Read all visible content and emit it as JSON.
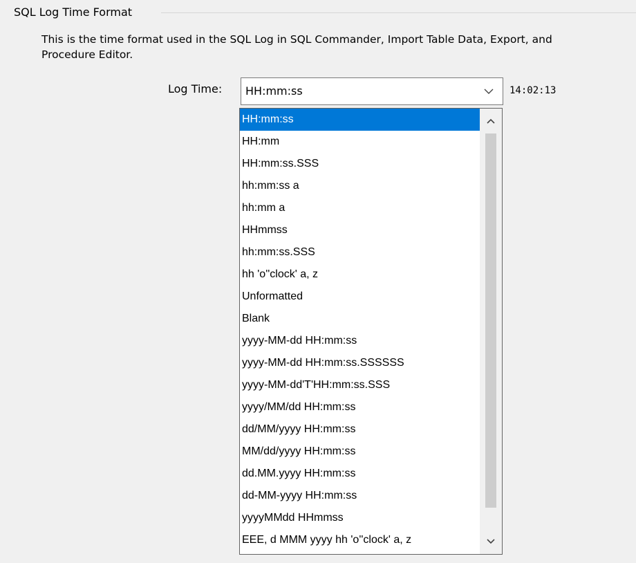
{
  "group": {
    "title": "SQL Log Time Format",
    "description_line1": "This is the time format used in the SQL Log in SQL Commander, Import Table Data, Export, and",
    "description_line2": "Procedure Editor."
  },
  "log_time": {
    "label": "Log Time:",
    "selected_value": "HH:mm:ss",
    "preview": "14:02:13",
    "dropdown_icon": "chevron-down-icon"
  },
  "dropdown": {
    "selected_index": 0,
    "options": [
      "HH:mm:ss",
      "HH:mm",
      "HH:mm:ss.SSS",
      "hh:mm:ss a",
      "hh:mm a",
      "HHmmss",
      "hh:mm:ss.SSS",
      "hh 'o''clock' a, z",
      "Unformatted",
      "Blank",
      "yyyy-MM-dd HH:mm:ss",
      "yyyy-MM-dd HH:mm:ss.SSSSSS",
      "yyyy-MM-dd'T'HH:mm:ss.SSS",
      "yyyy/MM/dd HH:mm:ss",
      "dd/MM/yyyy HH:mm:ss",
      "MM/dd/yyyy HH:mm:ss",
      "dd.MM.yyyy HH:mm:ss",
      "dd-MM-yyyy HH:mm:ss",
      "yyyyMMdd HHmmss",
      "EEE, d MMM yyyy hh 'o''clock' a, z"
    ]
  },
  "colors": {
    "selection": "#0078d7",
    "background": "#f0f0f0"
  }
}
